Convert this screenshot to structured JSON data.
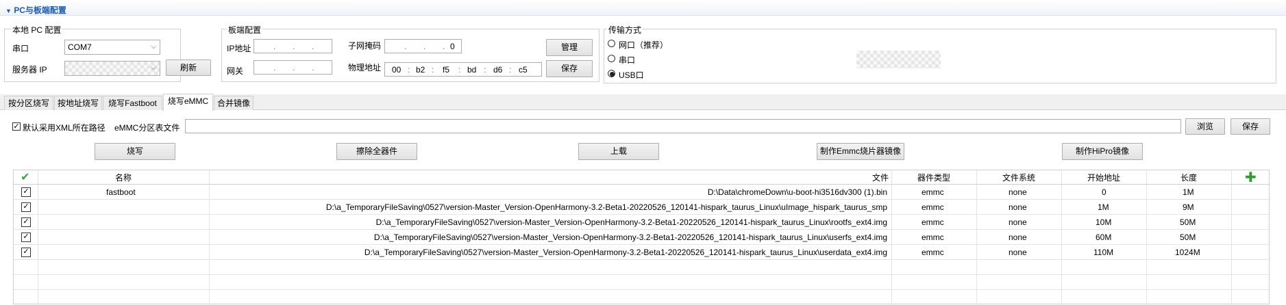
{
  "section": {
    "title": "PC与板端配置"
  },
  "local_pc": {
    "group_label": "本地 PC 配置",
    "port_label": "串口",
    "port_value": "COM7",
    "server_ip_label": "服务器 IP",
    "refresh_button": "刷新"
  },
  "board": {
    "group_label": "板端配置",
    "ip_label": "IP地址",
    "gateway_label": "网关",
    "subnet_label": "子网掩码",
    "subnet_last": "0",
    "mac_label": "物理地址",
    "mac": [
      "00",
      "b2",
      "f5",
      "bd",
      "d6",
      "c5"
    ],
    "manage_button": "管理",
    "save_button": "保存"
  },
  "transfer": {
    "group_label": "传输方式",
    "options": [
      "网口（推荐）",
      "串口",
      "USB口"
    ],
    "selected": "USB口"
  },
  "tabs": [
    "按分区烧写",
    "按地址烧写",
    "烧写Fastboot",
    "烧写eMMC",
    "合并镜像"
  ],
  "active_tab": "烧写eMMC",
  "emmc": {
    "use_xml_label": "默认采用XML所在路径",
    "table_file_label": "eMMC分区表文件",
    "table_file_value": "",
    "browse_button": "浏览",
    "save_button": "保存",
    "actions": [
      "烧写",
      "擦除全器件",
      "上载",
      "制作Emmc烧片器镜像",
      "制作HiPro镜像"
    ]
  },
  "table": {
    "columns": [
      "名称",
      "文件",
      "器件类型",
      "文件系统",
      "开始地址",
      "长度"
    ],
    "rows": [
      {
        "name": "fastboot",
        "file": "D:\\Data\\chromeDown\\u-boot-hi3516dv300 (1).bin",
        "device": "emmc",
        "fs": "none",
        "start": "0",
        "length": "1M"
      },
      {
        "name": "",
        "file": "D:\\a_TemporaryFileSaving\\0527\\version-Master_Version-OpenHarmony-3.2-Beta1-20220526_120141-hispark_taurus_Linux\\uImage_hispark_taurus_smp",
        "device": "emmc",
        "fs": "none",
        "start": "1M",
        "length": "9M"
      },
      {
        "name": "",
        "file": "D:\\a_TemporaryFileSaving\\0527\\version-Master_Version-OpenHarmony-3.2-Beta1-20220526_120141-hispark_taurus_Linux\\rootfs_ext4.img",
        "device": "emmc",
        "fs": "none",
        "start": "10M",
        "length": "50M"
      },
      {
        "name": "",
        "file": "D:\\a_TemporaryFileSaving\\0527\\version-Master_Version-OpenHarmony-3.2-Beta1-20220526_120141-hispark_taurus_Linux\\userfs_ext4.img",
        "device": "emmc",
        "fs": "none",
        "start": "60M",
        "length": "50M"
      },
      {
        "name": "",
        "file": "D:\\a_TemporaryFileSaving\\0527\\version-Master_Version-OpenHarmony-3.2-Beta1-20220526_120141-hispark_taurus_Linux\\userdata_ext4.img",
        "device": "emmc",
        "fs": "none",
        "start": "110M",
        "length": "1024M"
      }
    ]
  },
  "colors": {
    "accent": "#1e5bb8",
    "check_green": "#3aa53a",
    "add_green": "#2f9e2f"
  }
}
